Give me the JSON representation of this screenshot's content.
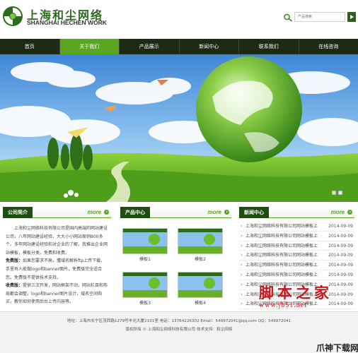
{
  "header": {
    "brand_cn": "上海和尘网络",
    "brand_en": "SHANGHAI HECHEN WORK",
    "search_placeholder": "产品搜索"
  },
  "nav": {
    "items": [
      "首页",
      "关于我们",
      "产品展示",
      "新闻中心",
      "联系我们",
      "在线咨询"
    ],
    "active_index": 1
  },
  "banner": {
    "slide_count": 2,
    "active_slide": 1
  },
  "intro": {
    "title": "公司简介",
    "more": "more",
    "p1": "上海和尘网络科技有限公司是国内高端的网站建设公司，八年网站建设经验，大大小小网站案例800多个。多年网站建设经验和对企业的了解，我推出企业网站模板，模板分类，免费和收费。",
    "free_label": "免费版：",
    "free_text": "如果您要求不高，懂域名解析ftp上传下载，手里有人能做logo和banner图片，免费版完全适合您。免费版不提供技术支持。",
    "paid_label": "收费版：",
    "paid_text": "提供三次开发，网站框架不动，网站栏目和布局都会调整，logo和banner图片设计，域名空间购买，教你如何使用后台上传内容等。"
  },
  "products": {
    "title": "产品中心",
    "more": "more",
    "items": [
      {
        "label": "模板1"
      },
      {
        "label": "模板2"
      },
      {
        "label": "模板3"
      },
      {
        "label": "模板4"
      }
    ]
  },
  "news": {
    "title": "新闻中心",
    "more": "more",
    "items": [
      {
        "title": "上海和尘网络科技有限公司网站模板上",
        "date": "2014-09-09"
      },
      {
        "title": "上海和尘网络科技有限公司网站模板上",
        "date": "2014-09-09"
      },
      {
        "title": "上海和尘网络科技有限公司网站模板上",
        "date": "2014-09-09"
      },
      {
        "title": "上海和尘网络科技有限公司网站模板上",
        "date": "2014-09-09"
      },
      {
        "title": "上海和尘网络科技有限公司网站模板上",
        "date": "2014-09-09"
      },
      {
        "title": "上海和尘网络科技有限公司网站模板上",
        "date": "2014-09-09"
      },
      {
        "title": "上海和尘网络科技有限公司网站模板上",
        "date": "2014-09-09"
      },
      {
        "title": "上海和尘网络科技有限公司网站模板上",
        "date": "2014-09-09"
      },
      {
        "title": "上海和尘网络科技有限公司网站模板上",
        "date": "2014-09-09"
      }
    ]
  },
  "footer": {
    "address": "地址：上海市长宁区茂西路1279号丰光大厦2101室  电话：13764226302  Email：549972041@qq.com  QQ：549972041",
    "copyright": "版权所有 © 上海和尘网络科技有限公司  技术支持：和尘网络"
  },
  "watermark": {
    "big": "脚本之家",
    "url": "www.jb51.net",
    "corner": "爪神下载网"
  },
  "colors": {
    "nav_bg": "#1e2a14",
    "nav_active": "#5aa622",
    "section_title_bg": "#1e4d10",
    "brand_green": "#2d6b1c",
    "watermark_red": "#c8161d"
  }
}
